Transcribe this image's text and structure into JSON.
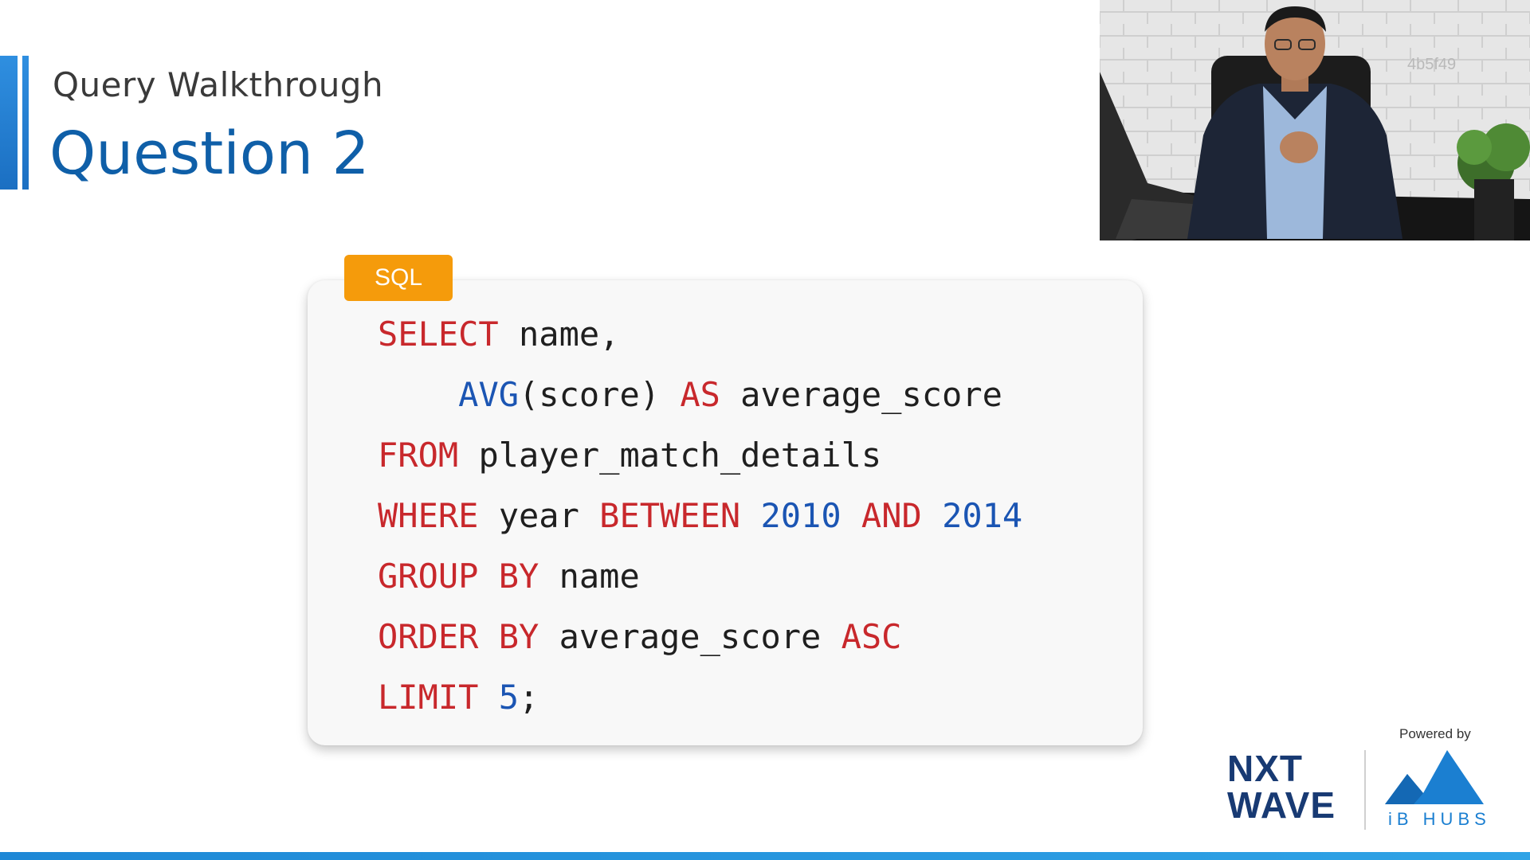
{
  "header": {
    "subtitle": "Query Walkthrough",
    "title": "Question 2"
  },
  "webcam": {
    "overlay_id": "4b5f49"
  },
  "code_block": {
    "language": "SQL",
    "lines": [
      [
        {
          "t": "SELECT",
          "c": "kw"
        },
        {
          "t": " name,",
          "c": "id"
        }
      ],
      [
        {
          "t": "    ",
          "c": "id"
        },
        {
          "t": "AVG",
          "c": "fn"
        },
        {
          "t": "(score) ",
          "c": "id"
        },
        {
          "t": "AS",
          "c": "kw"
        },
        {
          "t": " average_score",
          "c": "id"
        }
      ],
      [
        {
          "t": "FROM",
          "c": "kw"
        },
        {
          "t": " player_match_details",
          "c": "id"
        }
      ],
      [
        {
          "t": "WHERE",
          "c": "kw"
        },
        {
          "t": " year ",
          "c": "id"
        },
        {
          "t": "BETWEEN",
          "c": "kw"
        },
        {
          "t": " ",
          "c": "id"
        },
        {
          "t": "2010",
          "c": "num"
        },
        {
          "t": " ",
          "c": "id"
        },
        {
          "t": "AND",
          "c": "kw"
        },
        {
          "t": " ",
          "c": "id"
        },
        {
          "t": "2014",
          "c": "num"
        }
      ],
      [
        {
          "t": "GROUP BY",
          "c": "kw"
        },
        {
          "t": " name",
          "c": "id"
        }
      ],
      [
        {
          "t": "ORDER BY",
          "c": "kw"
        },
        {
          "t": " average_score ",
          "c": "id"
        },
        {
          "t": "ASC",
          "c": "kw"
        }
      ],
      [
        {
          "t": "LIMIT",
          "c": "kw"
        },
        {
          "t": " ",
          "c": "id"
        },
        {
          "t": "5",
          "c": "num"
        },
        {
          "t": ";",
          "c": "id"
        }
      ]
    ]
  },
  "branding": {
    "powered_by": "Powered by",
    "nxt": "NXT",
    "wave": "WAVE",
    "ibhubs": "iB HUBS"
  },
  "colors": {
    "keyword": "#c8282c",
    "function_number": "#1b55b3",
    "title_blue": "#0f5fa8",
    "badge_orange": "#f59b0b"
  }
}
